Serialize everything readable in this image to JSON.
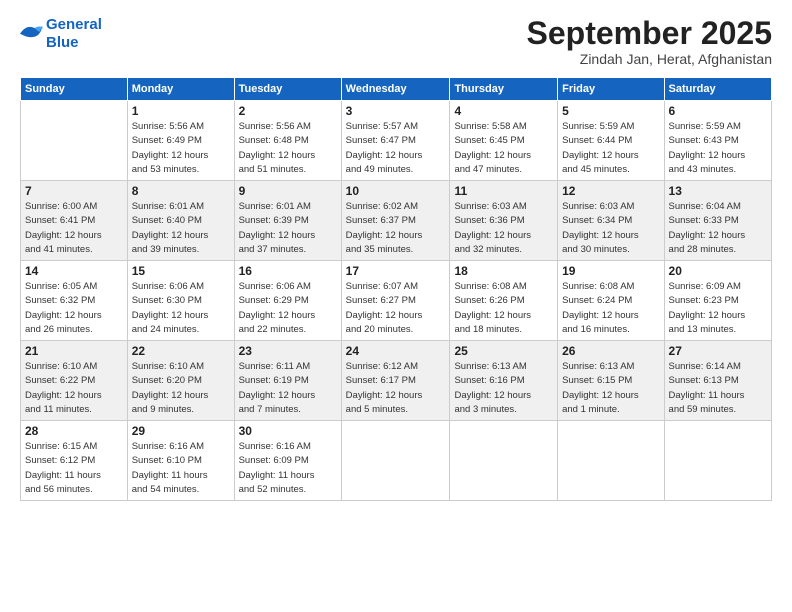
{
  "header": {
    "logo_line1": "General",
    "logo_line2": "Blue",
    "title": "September 2025",
    "subtitle": "Zindah Jan, Herat, Afghanistan"
  },
  "calendar": {
    "days_of_week": [
      "Sunday",
      "Monday",
      "Tuesday",
      "Wednesday",
      "Thursday",
      "Friday",
      "Saturday"
    ],
    "weeks": [
      [
        {
          "day": "",
          "info": ""
        },
        {
          "day": "1",
          "info": "Sunrise: 5:56 AM\nSunset: 6:49 PM\nDaylight: 12 hours\nand 53 minutes."
        },
        {
          "day": "2",
          "info": "Sunrise: 5:56 AM\nSunset: 6:48 PM\nDaylight: 12 hours\nand 51 minutes."
        },
        {
          "day": "3",
          "info": "Sunrise: 5:57 AM\nSunset: 6:47 PM\nDaylight: 12 hours\nand 49 minutes."
        },
        {
          "day": "4",
          "info": "Sunrise: 5:58 AM\nSunset: 6:45 PM\nDaylight: 12 hours\nand 47 minutes."
        },
        {
          "day": "5",
          "info": "Sunrise: 5:59 AM\nSunset: 6:44 PM\nDaylight: 12 hours\nand 45 minutes."
        },
        {
          "day": "6",
          "info": "Sunrise: 5:59 AM\nSunset: 6:43 PM\nDaylight: 12 hours\nand 43 minutes."
        }
      ],
      [
        {
          "day": "7",
          "info": "Sunrise: 6:00 AM\nSunset: 6:41 PM\nDaylight: 12 hours\nand 41 minutes."
        },
        {
          "day": "8",
          "info": "Sunrise: 6:01 AM\nSunset: 6:40 PM\nDaylight: 12 hours\nand 39 minutes."
        },
        {
          "day": "9",
          "info": "Sunrise: 6:01 AM\nSunset: 6:39 PM\nDaylight: 12 hours\nand 37 minutes."
        },
        {
          "day": "10",
          "info": "Sunrise: 6:02 AM\nSunset: 6:37 PM\nDaylight: 12 hours\nand 35 minutes."
        },
        {
          "day": "11",
          "info": "Sunrise: 6:03 AM\nSunset: 6:36 PM\nDaylight: 12 hours\nand 32 minutes."
        },
        {
          "day": "12",
          "info": "Sunrise: 6:03 AM\nSunset: 6:34 PM\nDaylight: 12 hours\nand 30 minutes."
        },
        {
          "day": "13",
          "info": "Sunrise: 6:04 AM\nSunset: 6:33 PM\nDaylight: 12 hours\nand 28 minutes."
        }
      ],
      [
        {
          "day": "14",
          "info": "Sunrise: 6:05 AM\nSunset: 6:32 PM\nDaylight: 12 hours\nand 26 minutes."
        },
        {
          "day": "15",
          "info": "Sunrise: 6:06 AM\nSunset: 6:30 PM\nDaylight: 12 hours\nand 24 minutes."
        },
        {
          "day": "16",
          "info": "Sunrise: 6:06 AM\nSunset: 6:29 PM\nDaylight: 12 hours\nand 22 minutes."
        },
        {
          "day": "17",
          "info": "Sunrise: 6:07 AM\nSunset: 6:27 PM\nDaylight: 12 hours\nand 20 minutes."
        },
        {
          "day": "18",
          "info": "Sunrise: 6:08 AM\nSunset: 6:26 PM\nDaylight: 12 hours\nand 18 minutes."
        },
        {
          "day": "19",
          "info": "Sunrise: 6:08 AM\nSunset: 6:24 PM\nDaylight: 12 hours\nand 16 minutes."
        },
        {
          "day": "20",
          "info": "Sunrise: 6:09 AM\nSunset: 6:23 PM\nDaylight: 12 hours\nand 13 minutes."
        }
      ],
      [
        {
          "day": "21",
          "info": "Sunrise: 6:10 AM\nSunset: 6:22 PM\nDaylight: 12 hours\nand 11 minutes."
        },
        {
          "day": "22",
          "info": "Sunrise: 6:10 AM\nSunset: 6:20 PM\nDaylight: 12 hours\nand 9 minutes."
        },
        {
          "day": "23",
          "info": "Sunrise: 6:11 AM\nSunset: 6:19 PM\nDaylight: 12 hours\nand 7 minutes."
        },
        {
          "day": "24",
          "info": "Sunrise: 6:12 AM\nSunset: 6:17 PM\nDaylight: 12 hours\nand 5 minutes."
        },
        {
          "day": "25",
          "info": "Sunrise: 6:13 AM\nSunset: 6:16 PM\nDaylight: 12 hours\nand 3 minutes."
        },
        {
          "day": "26",
          "info": "Sunrise: 6:13 AM\nSunset: 6:15 PM\nDaylight: 12 hours\nand 1 minute."
        },
        {
          "day": "27",
          "info": "Sunrise: 6:14 AM\nSunset: 6:13 PM\nDaylight: 11 hours\nand 59 minutes."
        }
      ],
      [
        {
          "day": "28",
          "info": "Sunrise: 6:15 AM\nSunset: 6:12 PM\nDaylight: 11 hours\nand 56 minutes."
        },
        {
          "day": "29",
          "info": "Sunrise: 6:16 AM\nSunset: 6:10 PM\nDaylight: 11 hours\nand 54 minutes."
        },
        {
          "day": "30",
          "info": "Sunrise: 6:16 AM\nSunset: 6:09 PM\nDaylight: 11 hours\nand 52 minutes."
        },
        {
          "day": "",
          "info": ""
        },
        {
          "day": "",
          "info": ""
        },
        {
          "day": "",
          "info": ""
        },
        {
          "day": "",
          "info": ""
        }
      ]
    ]
  }
}
